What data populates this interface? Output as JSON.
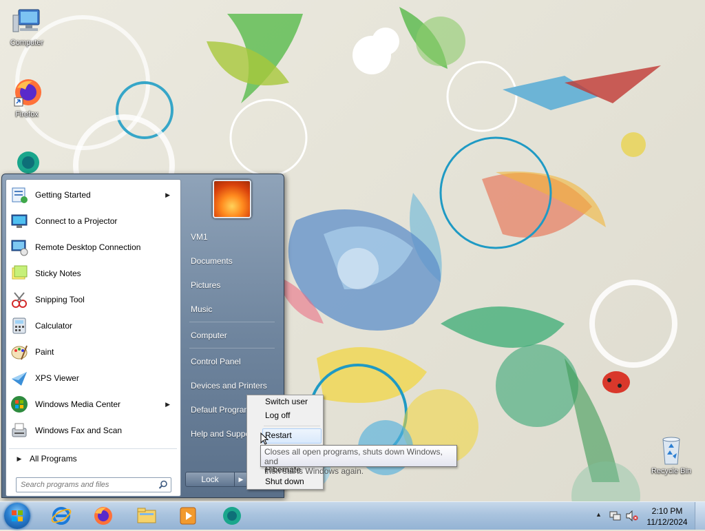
{
  "desktop": {
    "icons": [
      {
        "label": "Computer",
        "icon": "computer-icon"
      },
      {
        "label": "Firefox",
        "icon": "firefox-icon"
      },
      {
        "label": "",
        "icon": "app-icon"
      },
      {
        "label": "Recycle Bin",
        "icon": "recycle-bin-icon"
      }
    ]
  },
  "start_menu": {
    "programs": [
      {
        "label": "Getting Started",
        "icon": "getting-started-icon",
        "has_submenu": true
      },
      {
        "label": "Connect to a Projector",
        "icon": "projector-icon",
        "has_submenu": false
      },
      {
        "label": "Remote Desktop Connection",
        "icon": "remote-desktop-icon",
        "has_submenu": false
      },
      {
        "label": "Sticky Notes",
        "icon": "sticky-notes-icon",
        "has_submenu": false
      },
      {
        "label": "Snipping Tool",
        "icon": "snipping-tool-icon",
        "has_submenu": false
      },
      {
        "label": "Calculator",
        "icon": "calculator-icon",
        "has_submenu": false
      },
      {
        "label": "Paint",
        "icon": "paint-icon",
        "has_submenu": false
      },
      {
        "label": "XPS Viewer",
        "icon": "xps-viewer-icon",
        "has_submenu": false
      },
      {
        "label": "Windows Media Center",
        "icon": "media-center-icon",
        "has_submenu": true
      },
      {
        "label": "Windows Fax and Scan",
        "icon": "fax-scan-icon",
        "has_submenu": false
      }
    ],
    "all_programs": "All Programs",
    "search_placeholder": "Search programs and files",
    "right_items": [
      {
        "label": "VM1"
      },
      {
        "label": "Documents"
      },
      {
        "label": "Pictures"
      },
      {
        "label": "Music"
      },
      {
        "label": "Computer"
      },
      {
        "label": "Control Panel"
      },
      {
        "label": "Devices and Printers"
      },
      {
        "label": "Default Programs"
      },
      {
        "label": "Help and Support"
      }
    ],
    "lock_label": "Lock"
  },
  "power_menu": {
    "items": [
      "Switch user",
      "Log off",
      "Restart",
      "Hibernate",
      "Shut down"
    ],
    "highlighted": "Restart"
  },
  "tooltip": {
    "line1": "Closes all open programs, shuts down Windows, and",
    "line2": "then starts Windows again."
  },
  "taskbar": {
    "pinned": [
      "internet-explorer-icon",
      "firefox-icon",
      "file-explorer-icon",
      "media-player-icon",
      "app-icon"
    ],
    "clock_time": "2:10 PM",
    "clock_date": "11/12/2024"
  },
  "colors": {
    "taskbar": "#a9c3de",
    "start_menu_frame": "#6f859e",
    "highlight": "#d9e9fc"
  }
}
